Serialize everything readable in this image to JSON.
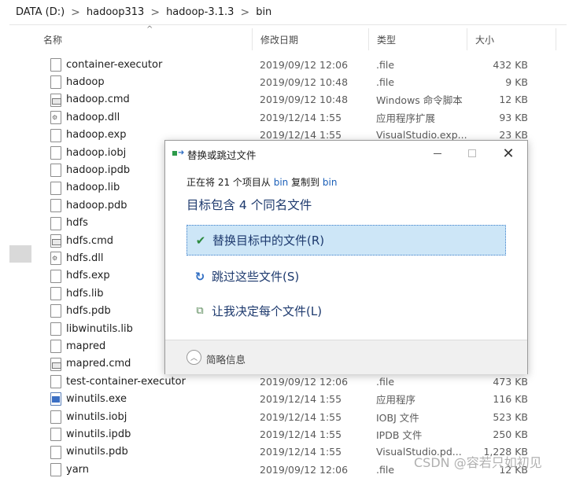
{
  "address": {
    "crumbs": [
      "DATA (D:)",
      "hadoop313",
      "hadoop-3.1.3",
      "bin"
    ],
    "separator": ">"
  },
  "columns": {
    "name": "名称",
    "date": "修改日期",
    "type": "类型",
    "size": "大小",
    "sort_arrow": "^"
  },
  "files": [
    {
      "name": "container-executor",
      "date": "2019/09/12 12:06",
      "type": ".file",
      "size": "432 KB",
      "icon": "file-icon"
    },
    {
      "name": "hadoop",
      "date": "2019/09/12 10:48",
      "type": ".file",
      "size": "9 KB",
      "icon": "file-icon"
    },
    {
      "name": "hadoop.cmd",
      "date": "2019/09/12 10:48",
      "type": "Windows 命令脚本",
      "size": "12 KB",
      "icon": "cmd-icon"
    },
    {
      "name": "hadoop.dll",
      "date": "2019/12/14 1:55",
      "type": "应用程序扩展",
      "size": "93 KB",
      "icon": "dll-icon"
    },
    {
      "name": "hadoop.exp",
      "date": "2019/12/14 1:55",
      "type": "VisualStudio.exp...",
      "size": "23 KB",
      "icon": "file-icon"
    },
    {
      "name": "hadoop.iobj",
      "date": "",
      "type": "",
      "size": "",
      "icon": "file-icon"
    },
    {
      "name": "hadoop.ipdb",
      "date": "",
      "type": "",
      "size": "",
      "icon": "file-icon"
    },
    {
      "name": "hadoop.lib",
      "date": "",
      "type": "",
      "size": "",
      "icon": "file-icon"
    },
    {
      "name": "hadoop.pdb",
      "date": "",
      "type": "",
      "size": "",
      "icon": "file-icon"
    },
    {
      "name": "hdfs",
      "date": "",
      "type": "",
      "size": "",
      "icon": "file-icon"
    },
    {
      "name": "hdfs.cmd",
      "date": "",
      "type": "",
      "size": "",
      "icon": "cmd-icon"
    },
    {
      "name": "hdfs.dll",
      "date": "",
      "type": "",
      "size": "",
      "icon": "dll-icon"
    },
    {
      "name": "hdfs.exp",
      "date": "",
      "type": "",
      "size": "",
      "icon": "file-icon"
    },
    {
      "name": "hdfs.lib",
      "date": "",
      "type": "",
      "size": "",
      "icon": "file-icon"
    },
    {
      "name": "hdfs.pdb",
      "date": "",
      "type": "",
      "size": "",
      "icon": "file-icon"
    },
    {
      "name": "libwinutils.lib",
      "date": "",
      "type": "",
      "size": "",
      "icon": "file-icon"
    },
    {
      "name": "mapred",
      "date": "",
      "type": "",
      "size": "",
      "icon": "file-icon"
    },
    {
      "name": "mapred.cmd",
      "date": "",
      "type": "",
      "size": "",
      "icon": "cmd-icon"
    },
    {
      "name": "test-container-executor",
      "date": "2019/09/12 12:06",
      "type": ".file",
      "size": "473 KB",
      "icon": "file-icon"
    },
    {
      "name": "winutils.exe",
      "date": "2019/12/14 1:55",
      "type": "应用程序",
      "size": "116 KB",
      "icon": "exe-icon"
    },
    {
      "name": "winutils.iobj",
      "date": "2019/12/14 1:55",
      "type": "IOBJ 文件",
      "size": "523 KB",
      "icon": "file-icon"
    },
    {
      "name": "winutils.ipdb",
      "date": "2019/12/14 1:55",
      "type": "IPDB 文件",
      "size": "250 KB",
      "icon": "file-icon"
    },
    {
      "name": "winutils.pdb",
      "date": "2019/12/14 1:55",
      "type": "VisualStudio.pd...",
      "size": "1,228 KB",
      "icon": "file-icon"
    },
    {
      "name": "yarn",
      "date": "2019/09/12 12:06",
      "type": ".file",
      "size": "12 KB",
      "icon": "file-icon"
    }
  ],
  "dialog": {
    "title": "替换或跳过文件",
    "progress_prefix": "正在将 21 个项目从 ",
    "source": "bin",
    "progress_mid": " 复制到 ",
    "dest": "bin",
    "heading": "目标包含 4 个同名文件",
    "options": [
      {
        "label": "替换目标中的文件(R)",
        "icon": "check-icon"
      },
      {
        "label": "跳过这些文件(S)",
        "icon": "skip-arrow-icon"
      },
      {
        "label": "让我决定每个文件(L)",
        "icon": "decide-files-icon"
      }
    ],
    "footer_label": "简略信息",
    "close_glyph": "✕"
  },
  "watermark": "CSDN @容若只如初见"
}
